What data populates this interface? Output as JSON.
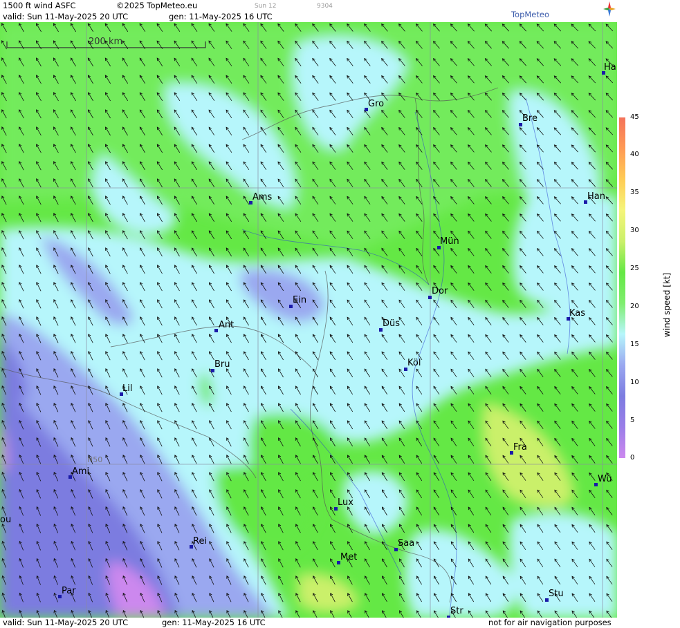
{
  "header": {
    "product": "1500 ft wind ASFC",
    "copyright": "©2025 TopMeteo.eu",
    "day_tag": "Sun 12",
    "code": "9304",
    "valid": "valid:  Sun  11-May-2025  20 UTC",
    "gen": "gen: 11-May-2025 16 UTC",
    "logo": "TopMeteo"
  },
  "footer": {
    "valid": "valid:  Sun  11-May-2025  20 UTC",
    "gen": "gen: 11-May-2025 16 UTC",
    "disclaimer": "not for air navigation purposes"
  },
  "scale_bar": {
    "label": "200 km"
  },
  "grid_label": "N50",
  "cities": [
    {
      "name": "Ha"
    },
    {
      "name": "Gro"
    },
    {
      "name": "Bre"
    },
    {
      "name": "Ams"
    },
    {
      "name": "Han"
    },
    {
      "name": "Mün"
    },
    {
      "name": "Ein"
    },
    {
      "name": "Dor"
    },
    {
      "name": "Kas"
    },
    {
      "name": "Ant"
    },
    {
      "name": "Düs"
    },
    {
      "name": "Köl"
    },
    {
      "name": "Bru"
    },
    {
      "name": "Lil"
    },
    {
      "name": "Fra"
    },
    {
      "name": "Ami"
    },
    {
      "name": "Wü"
    },
    {
      "name": "ou"
    },
    {
      "name": "Lux"
    },
    {
      "name": "Rei"
    },
    {
      "name": "Saa"
    },
    {
      "name": "Met"
    },
    {
      "name": "Stu"
    },
    {
      "name": "Par"
    },
    {
      "name": "Str"
    }
  ],
  "legend": {
    "title": "wind  speed  [kt]",
    "ticks": [
      "45",
      "40",
      "35",
      "30",
      "25",
      "20",
      "15",
      "10",
      "5",
      "0"
    ],
    "colors": [
      "#cc88ee",
      "#9a7ee8",
      "#7c7ce0",
      "#9aa8f0",
      "#b6f6fb",
      "#7fee6e",
      "#64e845",
      "#caf06a",
      "#f5f57a",
      "#ffcc55",
      "#ff9a55",
      "#f4735a"
    ]
  },
  "colors": {
    "wind_arrow": "#111111",
    "city_dot": "#1a1aa8",
    "grid": "#8a8aa0"
  }
}
